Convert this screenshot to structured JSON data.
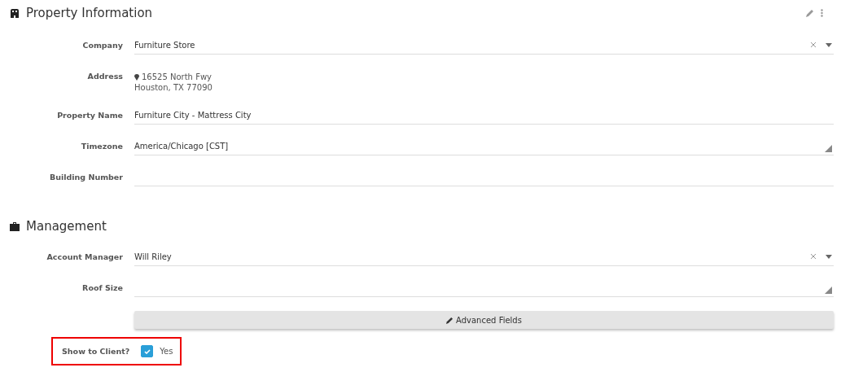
{
  "sections": [
    {
      "kind": "property",
      "title": "Property Information",
      "actions": true,
      "fields": [
        {
          "kind": "select",
          "label": "Company",
          "value": "Furniture Store"
        },
        {
          "kind": "address",
          "label": "Address",
          "lines": [
            "16525 North Fwy",
            "Houston, TX 77090"
          ]
        },
        {
          "kind": "text",
          "label": "Property Name",
          "value": "Furniture City - Mattress City"
        },
        {
          "kind": "textarea",
          "label": "Timezone",
          "value": "America/Chicago [CST]"
        },
        {
          "kind": "text",
          "label": "Building Number"
        }
      ]
    },
    {
      "kind": "management",
      "title": "Management",
      "actions": false,
      "fields": [
        {
          "kind": "select",
          "label": "Account Manager",
          "value": "Will Riley"
        },
        {
          "kind": "textarea",
          "label": "Roof Size"
        },
        {
          "kind": "button",
          "label": "Advanced Fields"
        },
        {
          "kind": "checkbox",
          "label": "Show to Client?",
          "value": "Yes",
          "checked": true,
          "highlighted": true
        }
      ]
    }
  ]
}
